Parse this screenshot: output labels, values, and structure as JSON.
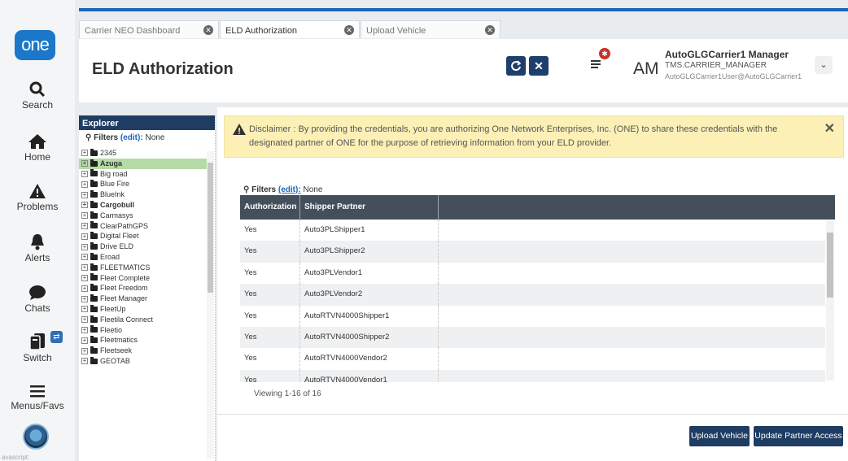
{
  "app": {
    "logo_text": "one"
  },
  "rail": [
    {
      "label": "Search",
      "icon": "search-icon"
    },
    {
      "label": "Home",
      "icon": "home-icon"
    },
    {
      "label": "Problems",
      "icon": "warning-icon"
    },
    {
      "label": "Alerts",
      "icon": "bell-icon"
    },
    {
      "label": "Chats",
      "icon": "chat-icon"
    },
    {
      "label": "Switch",
      "icon": "switch-icon"
    },
    {
      "label": "Menus/Favs",
      "icon": "hamburger-icon"
    }
  ],
  "rail_bottom_text": "avascript:",
  "tabs": [
    {
      "label": "Carrier NEO Dashboard"
    },
    {
      "label": "ELD Authorization"
    },
    {
      "label": "Upload Vehicle"
    }
  ],
  "header": {
    "title": "ELD Authorization",
    "refresh_icon": "refresh-icon",
    "close_icon": "close-icon"
  },
  "user": {
    "initials": "AM",
    "name": "AutoGLGCarrier1 Manager",
    "role": "TMS.CARRIER_MANAGER",
    "email": "AutoGLGCarrier1User@AutoGLGCarrier1"
  },
  "explorer": {
    "title": "Explorer",
    "filters_label": "Filters",
    "filters_edit": "(edit):",
    "filters_value": "None",
    "items": [
      {
        "label": "2345"
      },
      {
        "label": "Azuga"
      },
      {
        "label": "Big road"
      },
      {
        "label": "Blue Fire"
      },
      {
        "label": "BlueInk"
      },
      {
        "label": "Cargobull"
      },
      {
        "label": "Carmasys"
      },
      {
        "label": "ClearPathGPS"
      },
      {
        "label": "Digital Fleet"
      },
      {
        "label": "Drive ELD"
      },
      {
        "label": "Eroad"
      },
      {
        "label": "FLEETMATICS"
      },
      {
        "label": "Fleet Complete"
      },
      {
        "label": "Fleet Freedom"
      },
      {
        "label": "Fleet Manager"
      },
      {
        "label": "FleetUp"
      },
      {
        "label": "Fleetila Connect"
      },
      {
        "label": "Fleetio"
      },
      {
        "label": "Fleetmatics"
      },
      {
        "label": "Fleetseek"
      },
      {
        "label": "GEOTAB"
      }
    ]
  },
  "disclaimer": {
    "text": "Disclaimer : By providing the credentials, you are authorizing One Network Enterprises, Inc. (ONE) to share these credentials with the designated partner of ONE for the purpose of retrieving information from your ELD provider."
  },
  "table": {
    "filters_label": "Filters",
    "filters_edit": "(edit):",
    "filters_value": "None",
    "columns": [
      "Authorization",
      "Shipper Partner"
    ],
    "rows": [
      [
        "Yes",
        "Auto3PLShipper1"
      ],
      [
        "Yes",
        "Auto3PLShipper2"
      ],
      [
        "Yes",
        "Auto3PLVendor1"
      ],
      [
        "Yes",
        "Auto3PLVendor2"
      ],
      [
        "Yes",
        "AutoRTVN4000Shipper1"
      ],
      [
        "Yes",
        "AutoRTVN4000Shipper2"
      ],
      [
        "Yes",
        "AutoRTVN4000Vendor2"
      ],
      [
        "Yes",
        "AutoRTVN4000Vendor1"
      ]
    ],
    "viewing": "Viewing 1-16 of 16"
  },
  "footer": {
    "upload_vehicle": "Upload Vehicle",
    "update_partner_access": "Update Partner Access"
  }
}
